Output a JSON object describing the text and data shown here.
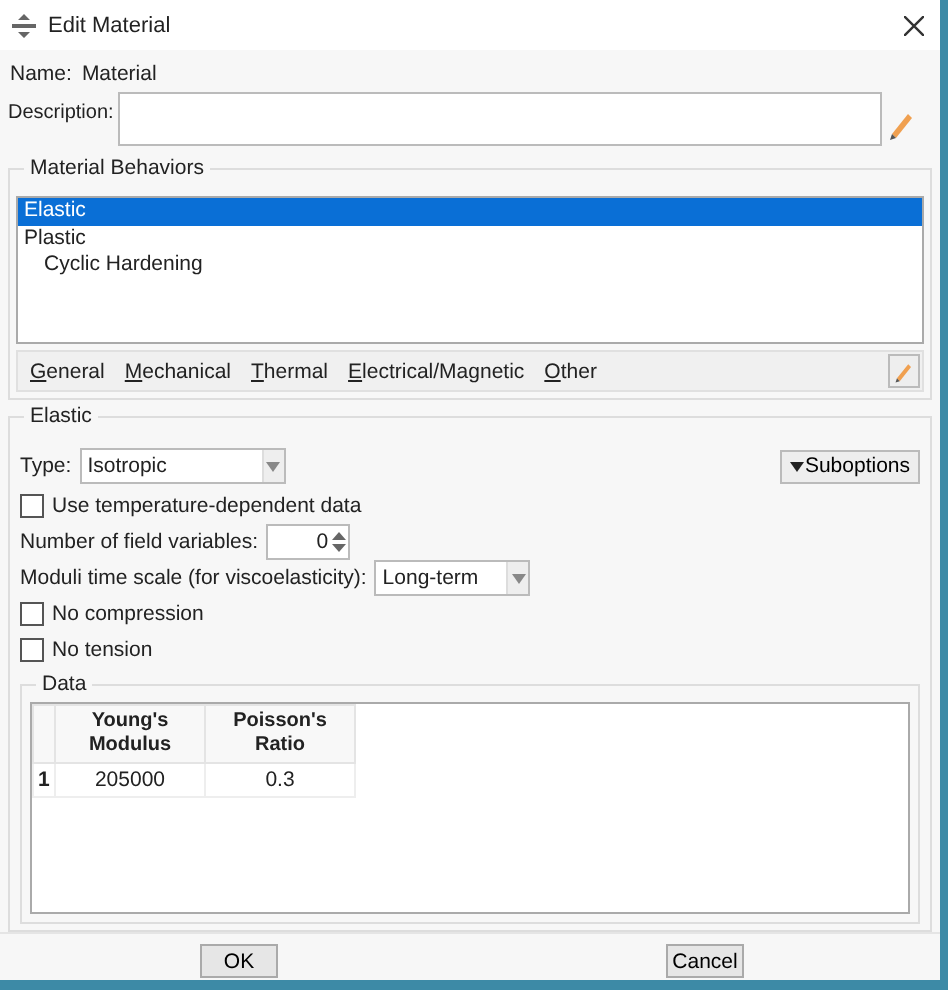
{
  "window": {
    "title": "Edit Material"
  },
  "name": {
    "label": "Name:",
    "value": "Material"
  },
  "description": {
    "label": "Description:"
  },
  "material_behaviors": {
    "title": "Material Behaviors",
    "items": [
      {
        "label": "Elastic",
        "selected": true
      },
      {
        "label": "Plastic",
        "selected": false,
        "children": [
          {
            "label": "Cyclic Hardening",
            "selected": false
          }
        ]
      }
    ],
    "menu": [
      "General",
      "Mechanical",
      "Thermal",
      "Electrical/Magnetic",
      "Other"
    ]
  },
  "elastic": {
    "title": "Elastic",
    "type": {
      "label": "Type:",
      "value": "Isotropic"
    },
    "suboptions": "Suboptions",
    "options": [
      {
        "kind": "checkbox",
        "label": "Use temperature-dependent data",
        "checked": false
      },
      {
        "kind": "spinner",
        "label": "Number of field variables:",
        "value": "0"
      },
      {
        "kind": "select",
        "label": "Moduli time scale (for viscoelasticity):",
        "value": "Long-term"
      },
      {
        "kind": "checkbox",
        "label": "No compression",
        "checked": false
      },
      {
        "kind": "checkbox",
        "label": "No tension",
        "checked": false
      }
    ],
    "data": {
      "title": "Data",
      "columns": [
        "Young's Modulus",
        "Poisson's Ratio"
      ],
      "rows": [
        {
          "index": "1",
          "cells": [
            "205000",
            "0.3"
          ]
        }
      ]
    }
  },
  "buttons": [
    "OK",
    "Cancel"
  ]
}
